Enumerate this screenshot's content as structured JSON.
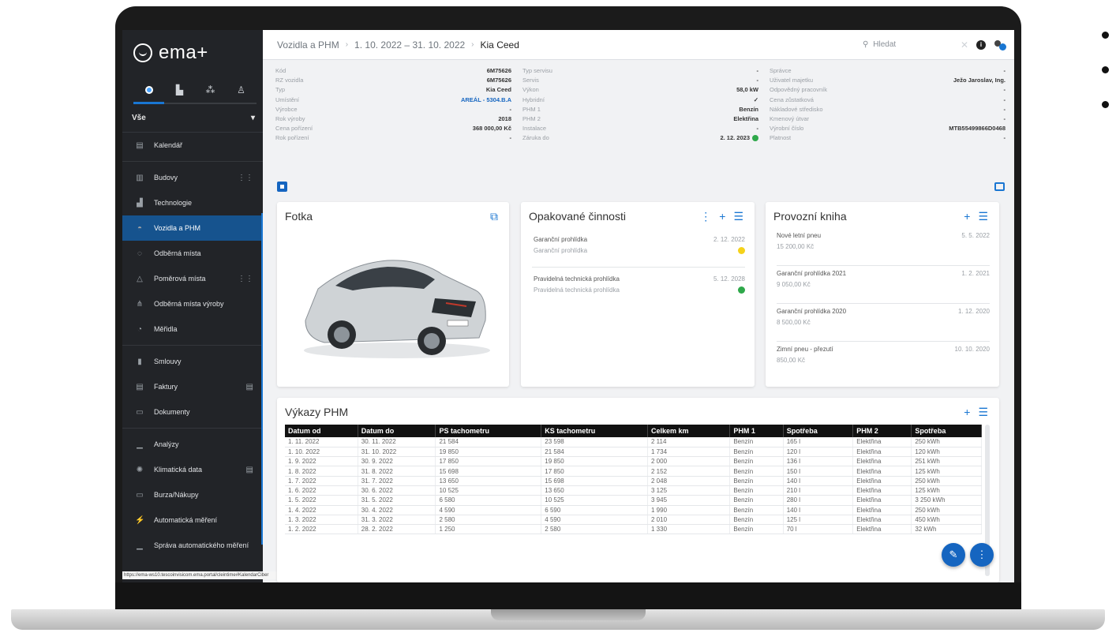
{
  "app": {
    "logo": "ema+"
  },
  "sidebar": {
    "filter": "Vše",
    "items": [
      {
        "label": "Kalendář",
        "icon": "calendar-icon",
        "glyph": "▤"
      },
      {
        "label": "Budovy",
        "icon": "building-icon",
        "glyph": "▥"
      },
      {
        "label": "Technologie",
        "icon": "factory-icon",
        "glyph": "▟"
      },
      {
        "label": "Vozidla a PHM",
        "icon": "car-icon",
        "glyph": "◓"
      },
      {
        "label": "Odběrná místa",
        "icon": "plug-icon",
        "glyph": "◌"
      },
      {
        "label": "Poměrová místa",
        "icon": "tree-icon",
        "glyph": "△"
      },
      {
        "label": "Odběrná místa výroby",
        "icon": "tower-icon",
        "glyph": "⋔"
      },
      {
        "label": "Měřidla",
        "icon": "gauge-icon",
        "glyph": "◔"
      },
      {
        "label": "Smlouvy",
        "icon": "contract-icon",
        "glyph": "▮"
      },
      {
        "label": "Faktury",
        "icon": "invoice-icon",
        "glyph": "▤"
      },
      {
        "label": "Dokumenty",
        "icon": "document-icon",
        "glyph": "▭"
      },
      {
        "label": "Analýzy",
        "icon": "analytics-icon",
        "glyph": "▁"
      },
      {
        "label": "Klimatická data",
        "icon": "sun-icon",
        "glyph": "✺"
      },
      {
        "label": "Burza/Nákupy",
        "icon": "exchange-icon",
        "glyph": "▭"
      },
      {
        "label": "Automatická měření",
        "icon": "meter-icon",
        "glyph": "⚡"
      },
      {
        "label": "Správa automatického měření",
        "icon": "settings-meter-icon",
        "glyph": "▁"
      }
    ],
    "status_url": "https://ema-ws10.tescoinvisicom.ema.portal/cleintime#KalendarCiber"
  },
  "topbar": {
    "crumbs": [
      "Vozidla a PHM",
      "1. 10. 2022 – 31. 10. 2022",
      "Kia Ceed"
    ],
    "search_placeholder": "Hledat"
  },
  "details": {
    "col1": [
      {
        "k": "Kód",
        "v": "6M75626"
      },
      {
        "k": "RZ vozidla",
        "v": "6M75626"
      },
      {
        "k": "Typ",
        "v": "Kia Ceed"
      },
      {
        "k": "Umístění",
        "v": "AREÁL - 5304.B.A"
      },
      {
        "k": "Výrobce",
        "v": "-"
      },
      {
        "k": "Rok výroby",
        "v": "2018"
      },
      {
        "k": "Cena pořízení",
        "v": "368 000,00 Kč"
      },
      {
        "k": "Rok pořízení",
        "v": "-"
      }
    ],
    "col2": [
      {
        "k": "Typ servisu",
        "v": "-"
      },
      {
        "k": "Servis",
        "v": "-"
      },
      {
        "k": "Výkon",
        "v": "58,0 kW"
      },
      {
        "k": "Hybridní",
        "v": "✓"
      },
      {
        "k": "PHM 1",
        "v": "Benzín"
      },
      {
        "k": "PHM 2",
        "v": "Elektřina"
      },
      {
        "k": "Instalace",
        "v": "-"
      },
      {
        "k": "Záruka do",
        "v": "2. 12. 2023"
      }
    ],
    "col3": [
      {
        "k": "Správce",
        "v": "-"
      },
      {
        "k": "Uživatel majetku",
        "v": "Ježo Jaroslav, Ing."
      },
      {
        "k": "Odpovědný pracovník",
        "v": "-"
      },
      {
        "k": "Cena zůstatková",
        "v": "-"
      },
      {
        "k": "Nákladové středisko",
        "v": "-"
      },
      {
        "k": "Kmenový útvar",
        "v": "-"
      },
      {
        "k": "Výrobní číslo",
        "v": "MTB55499866D0468"
      },
      {
        "k": "Platnost",
        "v": "-"
      }
    ]
  },
  "photo_card": {
    "title": "Fotka"
  },
  "opak_card": {
    "title": "Opakované činnosti",
    "items": [
      {
        "name": "Garanční prohlídka",
        "sub": "Garanční prohlídka",
        "date": "2. 12. 2022",
        "status": "yellow"
      },
      {
        "name": "Pravidelná technická prohlídka",
        "sub": "Pravidelná technická prohlídka",
        "date": "5. 12. 2028",
        "status": "green"
      }
    ]
  },
  "prov_card": {
    "title": "Provozní kniha",
    "items": [
      {
        "name": "Nové letní pneu",
        "date": "5. 5. 2022",
        "amount": "15 200,00 Kč"
      },
      {
        "name": "Garanční prohlídka 2021",
        "date": "1. 2. 2021",
        "amount": "9 050,00 Kč"
      },
      {
        "name": "Garanční prohlídka 2020",
        "date": "1. 12. 2020",
        "amount": "8 500,00 Kč"
      },
      {
        "name": "Zimní pneu - přezutí",
        "date": "10. 10. 2020",
        "amount": "850,00 Kč"
      }
    ]
  },
  "vykazy": {
    "title": "Výkazy PHM",
    "columns": [
      "Datum od",
      "Datum do",
      "PS tachometru",
      "KS tachometru",
      "Celkem km",
      "PHM 1",
      "Spotřeba",
      "PHM 2",
      "Spotřeba"
    ],
    "rows": [
      [
        "1. 11. 2022",
        "30. 11. 2022",
        "21 584",
        "23 598",
        "2 114",
        "Benzín",
        "165 l",
        "Elektřina",
        "250 kWh"
      ],
      [
        "1. 10. 2022",
        "31. 10. 2022",
        "19 850",
        "21 584",
        "1 734",
        "Benzín",
        "120 l",
        "Elektřina",
        "120 kWh"
      ],
      [
        "1. 9. 2022",
        "30. 9. 2022",
        "17 850",
        "19 850",
        "2 000",
        "Benzín",
        "136 l",
        "Elektřina",
        "251 kWh"
      ],
      [
        "1. 8. 2022",
        "31. 8. 2022",
        "15 698",
        "17 850",
        "2 152",
        "Benzín",
        "150 l",
        "Elektřina",
        "125 kWh"
      ],
      [
        "1. 7. 2022",
        "31. 7. 2022",
        "13 650",
        "15 698",
        "2 048",
        "Benzín",
        "140 l",
        "Elektřina",
        "250 kWh"
      ],
      [
        "1. 6. 2022",
        "30. 6. 2022",
        "10 525",
        "13 650",
        "3 125",
        "Benzín",
        "210 l",
        "Elektřina",
        "125 kWh"
      ],
      [
        "1. 5. 2022",
        "31. 5. 2022",
        "6 580",
        "10 525",
        "3 945",
        "Benzín",
        "280 l",
        "Elektřina",
        "3 250 kWh"
      ],
      [
        "1. 4. 2022",
        "30. 4. 2022",
        "4 590",
        "6 590",
        "1 990",
        "Benzín",
        "140 l",
        "Elektřina",
        "250 kWh"
      ],
      [
        "1. 3. 2022",
        "31. 3. 2022",
        "2 580",
        "4 590",
        "2 010",
        "Benzín",
        "125 l",
        "Elektřina",
        "450 kWh"
      ],
      [
        "1. 2. 2022",
        "28. 2. 2022",
        "1 250",
        "2 580",
        "1 330",
        "Benzín",
        "70 l",
        "Elektřina",
        "32 kWh"
      ]
    ]
  },
  "colors": {
    "accent": "#1976d2",
    "sidebar": "#222428",
    "active": "#16538e"
  }
}
